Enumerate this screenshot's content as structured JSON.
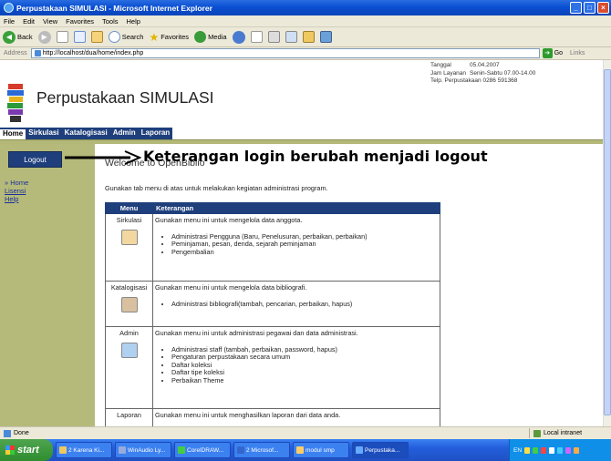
{
  "window": {
    "title": "Perpustakaan SIMULASI - Microsoft Internet Explorer"
  },
  "menubar": [
    "File",
    "Edit",
    "View",
    "Favorites",
    "Tools",
    "Help"
  ],
  "toolbar": {
    "back": "Back",
    "search": "Search",
    "favorites": "Favorites",
    "media": "Media"
  },
  "address": {
    "label": "Address",
    "url": "http://localhost/dua/home/index.php",
    "go": "Go",
    "links": "Links"
  },
  "header": {
    "title": "Perpustakaan SIMULASI",
    "info": [
      {
        "label": "Tanggal",
        "value": "05.04.2007"
      },
      {
        "label": "Jam Layanan",
        "value": "Senin-Sabtu 07.00-14.00"
      },
      {
        "label": "Telp. Perpustakaan 0286 591368",
        "value": ""
      }
    ]
  },
  "tabs": [
    {
      "label": "Home",
      "active": true
    },
    {
      "label": "Sirkulasi"
    },
    {
      "label": "Katalogisasi"
    },
    {
      "label": "Admin"
    },
    {
      "label": "Laporan"
    }
  ],
  "sidebar": {
    "logout": "Logout",
    "links": [
      {
        "label": "» Home"
      },
      {
        "label": "Lisensi"
      },
      {
        "label": "Help"
      }
    ]
  },
  "main": {
    "welcome": "Welcome to OpenBiblio",
    "annotation": "Keterangan login berubah menjadi logout",
    "intro": "Gunakan tab menu di atas untuk melakukan kegiatan administrasi program.",
    "table": {
      "headers": [
        "Menu",
        "Keterangan"
      ],
      "rows": [
        {
          "menu": "Sirkulasi",
          "desc": "Gunakan menu ini untuk mengelola data anggota.",
          "items": [
            "Administrasi Pengguna (Baru, Penelusuran, perbaikan, perbaikan)",
            "Peminjaman, pesan, denda, sejarah peminjaman",
            "Pengembalian"
          ]
        },
        {
          "menu": "Katalogisasi",
          "desc": "Gunakan menu ini untuk mengelola data bibliografi.",
          "items": [
            "Administrasi bibliografi(tambah, pencarian, perbaikan, hapus)"
          ]
        },
        {
          "menu": "Admin",
          "desc": "Gunakan menu ini untuk administrasi pegawai dan data administrasi.",
          "items": [
            "Administrasi staff (tambah, perbaikan, password, hapus)",
            "Pengaturan perpustakaan secara umum",
            "Daftar koleksi",
            "Daftar tipe koleksi",
            "Perbaikan Theme"
          ]
        },
        {
          "menu": "Laporan",
          "desc": "Gunakan menu ini untuk menghasilkan laporan dari data anda.",
          "items": []
        }
      ]
    }
  },
  "statusbar": {
    "left": "Done",
    "zone": "Local intranet"
  },
  "taskbar": {
    "start": "start",
    "tasks": [
      "2 Karena Ki...",
      "WinAudio Ly...",
      "CorelDRAW...",
      "2 Microsof...",
      "modul smp",
      "Perpustaka..."
    ],
    "tray": "EN"
  },
  "colors": {
    "nav": "#1f3f7c",
    "sidebar": "#b5ba7a",
    "titlebar": "#0a4fd2"
  }
}
